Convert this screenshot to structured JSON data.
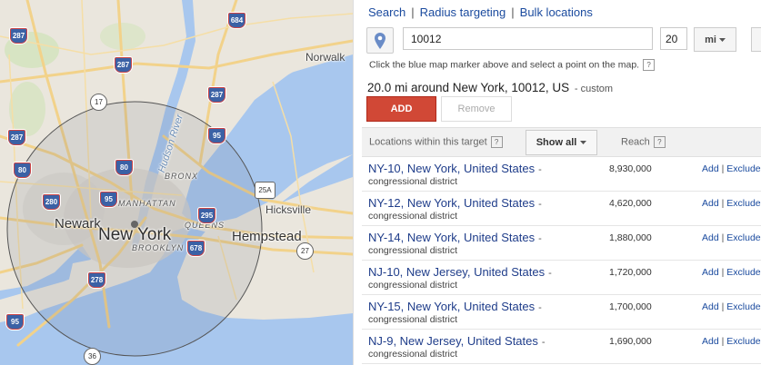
{
  "map": {
    "labels": {
      "norwalk": "Norwalk",
      "hudson_river": "Hudson River",
      "bronx": "BRONX",
      "manhattan": "MANHATTAN",
      "queens": "QUEENS",
      "brooklyn": "BROOKLYN",
      "newark": "Newark",
      "new_york": "New York",
      "hicksville": "Hicksville",
      "hempstead": "Hempstead"
    },
    "shields": {
      "i684": "684",
      "i287a": "287",
      "i287b": "287",
      "i287c": "287",
      "i287d": "287",
      "i95a": "95",
      "i95b": "95",
      "i95c": "95",
      "i80a": "80",
      "i80b": "80",
      "i280": "280",
      "i295": "295",
      "i678": "678",
      "i278": "278"
    },
    "routes": {
      "r17": "17",
      "r25a": "25A",
      "r27": "27",
      "r36": "36"
    }
  },
  "targeting": {
    "tabs": [
      "Search",
      "Radius targeting",
      "Bulk locations"
    ],
    "location_value": "10012",
    "radius_value": "20",
    "unit_label": "mi",
    "hint": "Click the blue map marker above and select a point on the map.",
    "help_symbol": "?",
    "summary": "20.0 mi around New York, 10012, US",
    "summary_tag": "- custom",
    "add_label": "ADD",
    "remove_label": "Remove"
  },
  "table": {
    "locations_header": "Locations within this target",
    "show_all_label": "Show all",
    "reach_header": "Reach",
    "add_link": "Add",
    "exclude_link": "Exclude",
    "action_sep": "|",
    "rows": [
      {
        "name": "NY-10, New York, United States",
        "type": "congressional district",
        "reach": "8,930,000"
      },
      {
        "name": "NY-12, New York, United States",
        "type": "congressional district",
        "reach": "4,620,000"
      },
      {
        "name": "NY-14, New York, United States",
        "type": "congressional district",
        "reach": "1,880,000"
      },
      {
        "name": "NJ-10, New Jersey, United States",
        "type": "congressional district",
        "reach": "1,720,000"
      },
      {
        "name": "NY-15, New York, United States",
        "type": "congressional district",
        "reach": "1,700,000"
      },
      {
        "name": "NJ-9, New Jersey, United States",
        "type": "congressional district",
        "reach": "1,690,000"
      }
    ]
  },
  "colors": {
    "add_button": "#d14836",
    "link": "#1a4a9e",
    "water": "#a8c7ee",
    "land": "#eae6dd",
    "road": "#f2d28a"
  }
}
